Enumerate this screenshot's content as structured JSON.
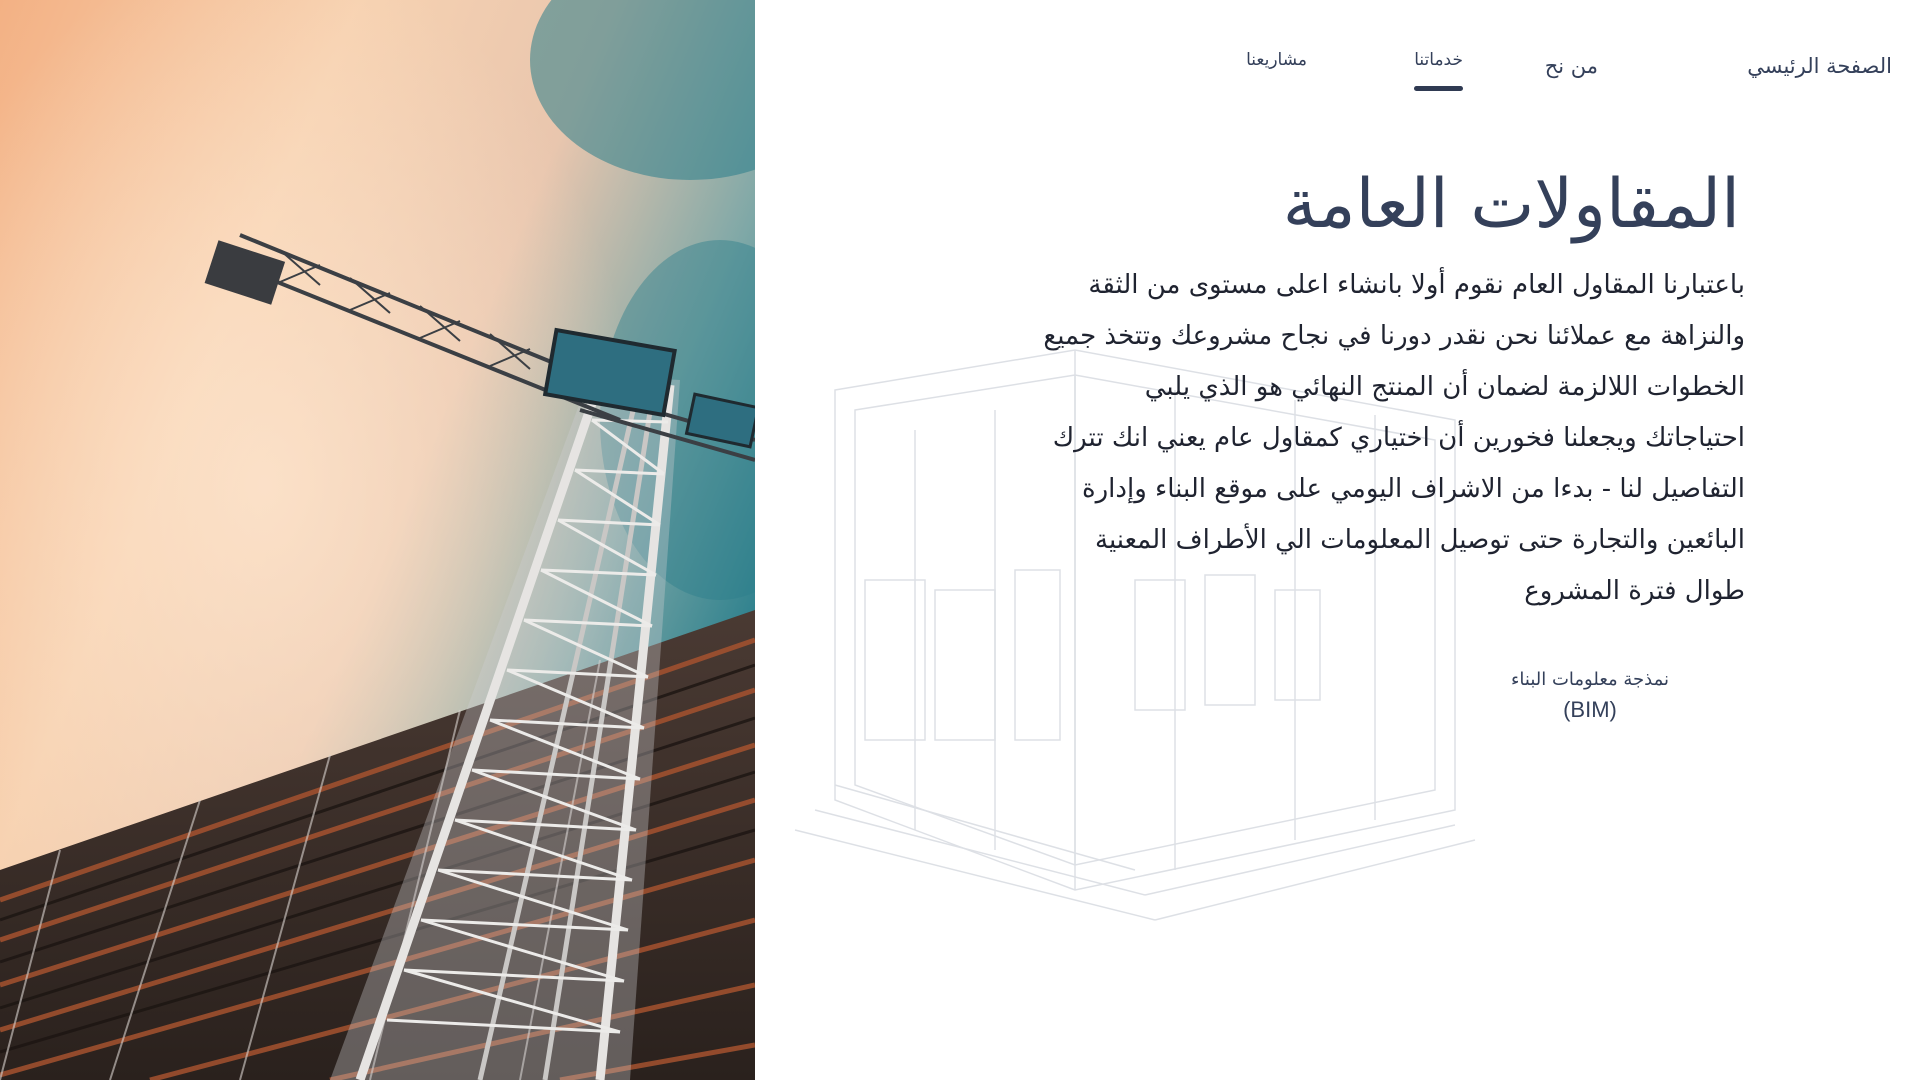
{
  "nav": {
    "items": [
      {
        "label": "الصفحة الرئيسي",
        "active": false
      },
      {
        "label": "من نح",
        "active": false
      },
      {
        "label": "خدماتنا",
        "active": true
      },
      {
        "label": "مشاريعنا",
        "active": false
      }
    ]
  },
  "main": {
    "title": "المقاولات العامة",
    "body_lines": [
      "باعتبارنا المقاول العام نقوم أولا بانشاء اعلى مستوى من الثقة",
      "والنزاهة مع عملائنا نحن نقدر دورنا في نجاح مشروعك وتتخذ جميع",
      "الخطوات اللالزمة لضمان أن المنتج النهائي هو الذي يلبي",
      "احتياجاتك ويجعلنا فخورين أن اختياري كمقاول عام يعني انك تترك",
      "التفاصيل لنا - بدءا من الاشراف اليومي على موقع البناء وإدارة",
      "البائعين والتجارة حتى توصيل المعلومات الي الأطراف المعنية",
      "طوال فترة المشروع"
    ],
    "bim_arabic": "نمذجة معلومات البناء",
    "bim_english": "(BIM)"
  },
  "colors": {
    "text_primary": "#34405a",
    "body_text": "#1f2330",
    "nav_underline": "#2f3a52",
    "background": "#ffffff"
  },
  "icons": {
    "hero": "crane-photo",
    "background_art": "building-wireframe"
  }
}
